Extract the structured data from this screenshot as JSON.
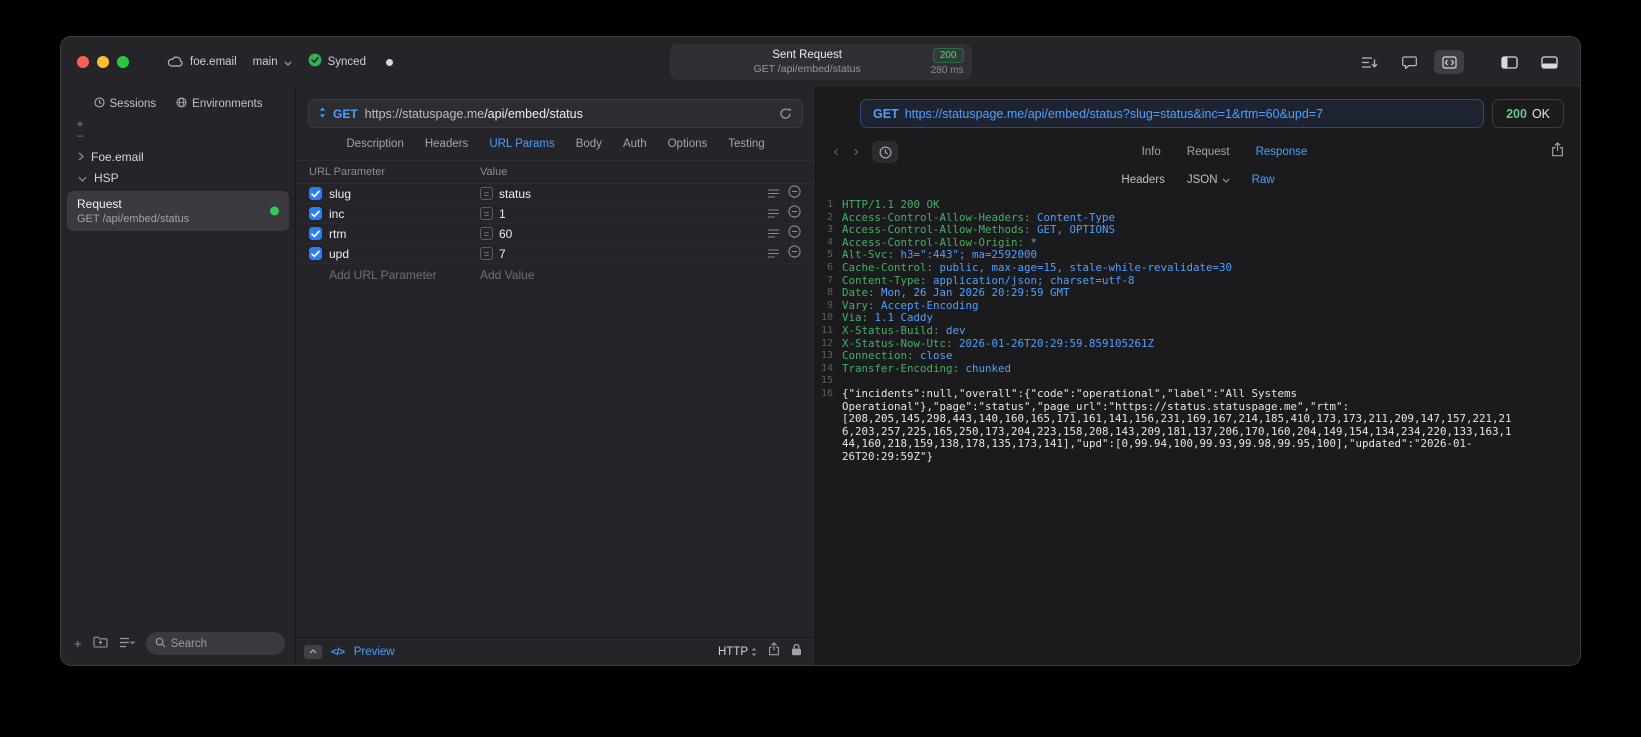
{
  "icons": {
    "plus": "+",
    "minus": "−",
    "back": "‹",
    "forward": "›",
    "equals": "=",
    "code": "</>"
  },
  "colors": {
    "accent": "#4a9eff",
    "url_blue": "#4da0ff",
    "success": "#32d74b",
    "checkbox": "#2e7cf6",
    "resp_key": "#43b062",
    "resp_value": "#4da0ff",
    "resp_body": "#e6e6e8"
  },
  "titlebar": {
    "project": "foe.email",
    "branch": "main",
    "sync_status": "Synced",
    "request_summary": {
      "title": "Sent Request",
      "subtitle": "GET /api/embed/status",
      "status_code": "200",
      "duration": "280 ms"
    }
  },
  "sidebar": {
    "tabs": [
      {
        "label": "Sessions"
      },
      {
        "label": "Environments"
      }
    ],
    "tree": [
      {
        "label": "Foe.email"
      },
      {
        "label": "HSP"
      }
    ],
    "selected_request": {
      "title": "Request",
      "subtitle": "GET /api/embed/status"
    },
    "search_placeholder": "Search"
  },
  "request_editor": {
    "method": "GET",
    "url_host": "https://statuspage.me",
    "url_path": "/api/embed/status",
    "tabs": [
      "Description",
      "Headers",
      "URL Params",
      "Body",
      "Auth",
      "Options",
      "Testing"
    ],
    "active_tab": "URL Params",
    "params_table": {
      "columns": [
        "URL Parameter",
        "Value"
      ],
      "rows": [
        {
          "name": "slug",
          "value": "status",
          "checked": true
        },
        {
          "name": "inc",
          "value": "1",
          "checked": true
        },
        {
          "name": "rtm",
          "value": "60",
          "checked": true
        },
        {
          "name": "upd",
          "value": "7",
          "checked": true
        }
      ],
      "add_row": {
        "name_placeholder": "Add URL Parameter",
        "value_placeholder": "Add Value"
      }
    },
    "footer": {
      "preview_label": "Preview",
      "protocol_label": "HTTP"
    }
  },
  "response_viewer": {
    "method": "GET",
    "url": "https://statuspage.me/api/embed/status?slug=status&inc=1&rtm=60&upd=7",
    "status_code": "200",
    "status_text": "OK",
    "tabs": [
      "Info",
      "Request",
      "Response"
    ],
    "active_tab": "Response",
    "format_tabs": [
      {
        "label": "Headers"
      },
      {
        "label": "JSON",
        "has_dropdown": true
      },
      {
        "label": "Raw"
      }
    ],
    "active_format_tab": "Raw",
    "lines": [
      {
        "num": "1",
        "segments": [
          {
            "color": "key",
            "text": "HTTP/1.1 200 OK"
          }
        ]
      },
      {
        "num": "2",
        "segments": [
          {
            "color": "key",
            "text": "Access-Control-Allow-Headers: "
          },
          {
            "color": "value",
            "text": "Content-Type"
          }
        ]
      },
      {
        "num": "3",
        "segments": [
          {
            "color": "key",
            "text": "Access-Control-Allow-Methods: "
          },
          {
            "color": "value",
            "text": "GET, OPTIONS"
          }
        ]
      },
      {
        "num": "4",
        "segments": [
          {
            "color": "key",
            "text": "Access-Control-Allow-Origin: "
          },
          {
            "color": "value",
            "text": "*"
          }
        ]
      },
      {
        "num": "5",
        "segments": [
          {
            "color": "key",
            "text": "Alt-Svc: "
          },
          {
            "color": "value",
            "text": "h3=\":443\"; ma=2592000"
          }
        ]
      },
      {
        "num": "6",
        "segments": [
          {
            "color": "key",
            "text": "Cache-Control: "
          },
          {
            "color": "value",
            "text": "public, max-age=15, stale-while-revalidate=30"
          }
        ]
      },
      {
        "num": "7",
        "segments": [
          {
            "color": "key",
            "text": "Content-Type: "
          },
          {
            "color": "value",
            "text": "application/json; charset=utf-8"
          }
        ]
      },
      {
        "num": "8",
        "segments": [
          {
            "color": "key",
            "text": "Date: "
          },
          {
            "color": "value",
            "text": "Mon, 26 Jan 2026 20:29:59 GMT"
          }
        ]
      },
      {
        "num": "9",
        "segments": [
          {
            "color": "key",
            "text": "Vary: "
          },
          {
            "color": "value",
            "text": "Accept-Encoding"
          }
        ]
      },
      {
        "num": "10",
        "segments": [
          {
            "color": "key",
            "text": "Via: "
          },
          {
            "color": "value",
            "text": "1.1 Caddy"
          }
        ]
      },
      {
        "num": "11",
        "segments": [
          {
            "color": "key",
            "text": "X-Status-Build: "
          },
          {
            "color": "value",
            "text": "dev"
          }
        ]
      },
      {
        "num": "12",
        "segments": [
          {
            "color": "key",
            "text": "X-Status-Now-Utc: "
          },
          {
            "color": "value",
            "text": "2026-01-26T20:29:59.859105261Z"
          }
        ]
      },
      {
        "num": "13",
        "segments": [
          {
            "color": "key",
            "text": "Connection: "
          },
          {
            "color": "value",
            "text": "close"
          }
        ]
      },
      {
        "num": "14",
        "segments": [
          {
            "color": "key",
            "text": "Transfer-Encoding: "
          },
          {
            "color": "value",
            "text": "chunked"
          }
        ]
      },
      {
        "num": "15",
        "segments": []
      },
      {
        "num": "16",
        "segments": [
          {
            "color": "body",
            "text": "{\"incidents\":null,\"overall\":{\"code\":\"operational\",\"label\":\"All Systems Operational\"},\"page\":\"status\",\"page_url\":\"https://status.statuspage.me\",\"rtm\":[208,205,145,298,443,140,160,165,171,161,141,156,231,169,167,214,185,410,173,173,211,209,147,157,221,216,203,257,225,165,250,173,204,223,158,208,143,209,181,137,206,170,160,204,149,154,134,234,220,133,163,144,160,218,159,138,178,135,173,141],\"upd\":[0,99.94,100,99.93,99.98,99.95,100],\"updated\":\"2026-01-26T20:29:59Z\"}"
          }
        ]
      }
    ]
  }
}
